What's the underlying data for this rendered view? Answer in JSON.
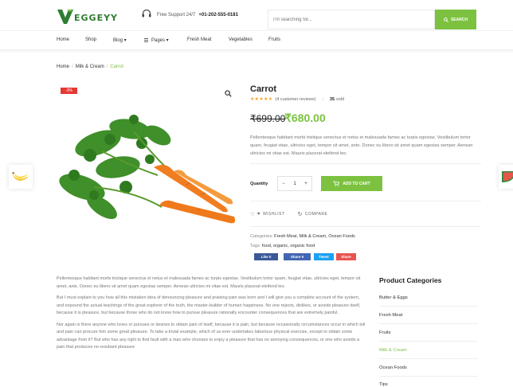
{
  "header": {
    "logo_text": "EGGEYY",
    "support_label": "Free Support 24/7",
    "support_phone": "+01-202-555-0181",
    "search_placeholder": "I'm searching for...",
    "search_button": "SEARCH"
  },
  "nav": {
    "items": [
      {
        "label": "Home"
      },
      {
        "label": "Shop"
      },
      {
        "label": "Blog ▾"
      },
      {
        "label": "Pages ▾"
      },
      {
        "label": "Fresh Meat"
      },
      {
        "label": "Vegetables"
      },
      {
        "label": "Fruits"
      }
    ]
  },
  "breadcrumb": [
    "Home",
    "Milk & Cream",
    "Carrot"
  ],
  "product": {
    "badge": "-3%",
    "title": "Carrot",
    "stars": "★★★★★",
    "reviews": "(4 customer reviews)",
    "sold_count": "35",
    "sold_label": "sold",
    "old_price": "₹699.00",
    "new_price": "₹680.00",
    "description": "Pellentesque habitant morbi tristique senectus et netus et malesuada fames ac turpis egestas. Vestibulum tortor quam, feugiat vitae, ultricies eget, tempor sit amet, ante. Donec eu libero sit amet quam egestas semper. Aenean ultricies mi vitae est. Mauris placerat eleifend leo.",
    "quantity_label": "Quantity",
    "quantity_minus": "−",
    "quantity_value": "1",
    "quantity_plus": "+",
    "add_to_cart": "ADD TO CART",
    "wishlist": "WISHLIST",
    "compare": "COMPARE",
    "categories_label": "Categories:",
    "categories_value": "Fresh Meat, Milk & Cream, Ocean Foods",
    "tags_label": "Tags:",
    "tags_value": "food, organic, organic food",
    "share": [
      {
        "label": "Like 0",
        "color": "#3b5998"
      },
      {
        "label": "Share 0",
        "color": "#4267b2"
      },
      {
        "label": "Tweet",
        "color": "#1da1f2"
      },
      {
        "label": "Share",
        "color": "#e9544f"
      }
    ]
  },
  "details": {
    "paragraphs": [
      "Pellentesque habitant morbi tristique senectus et netus et malesuada fames ac turpis egestas. Vestibulum tortor quam, feugiat vitae, ultricies eget, tempor sit amet, ante. Donec eu libero sit amet quam egestas semper. Aenean ultricies mi vitae est. Mauris placerat eleifend leo.",
      "But I must explain to you how all this mistaken idea of denouncing pleasure and praising pain was born and I will give you a complete account of the system, and expound the actual teachings of the great explorer of the truth, the master-builder of human happiness. No one rejects, dislikes, or avoids pleasure itself, because it is pleasure, but because those who do not know how to pursue pleasure rationally encounter consequences that are extremely painful.",
      "Nor again is there anyone who loves or pursues or desires to obtain pain of itself, because it is pain, but because occasionally circumstances occur in which toil and pain can procure him some great pleasure. To take a trivial example, which of us ever undertakes laborious physical exercise, except to obtain some advantage from it? But who has any right to find fault with a man who chooses to enjoy a pleasure that has no annoying consequences, or one who avoids a pain that produces no resultant pleasure"
    ]
  },
  "sidebar": {
    "title": "Product Categories",
    "items": [
      {
        "label": "Butter & Eggs"
      },
      {
        "label": "Fresh Meat"
      },
      {
        "label": "Fruits"
      },
      {
        "label": "Milk & Cream"
      },
      {
        "label": "Ocean Foods"
      },
      {
        "label": "Tips"
      }
    ],
    "active_index": 3
  },
  "colors": {
    "accent": "#7cc240",
    "sale": "#e53935",
    "star": "#f5a623"
  }
}
